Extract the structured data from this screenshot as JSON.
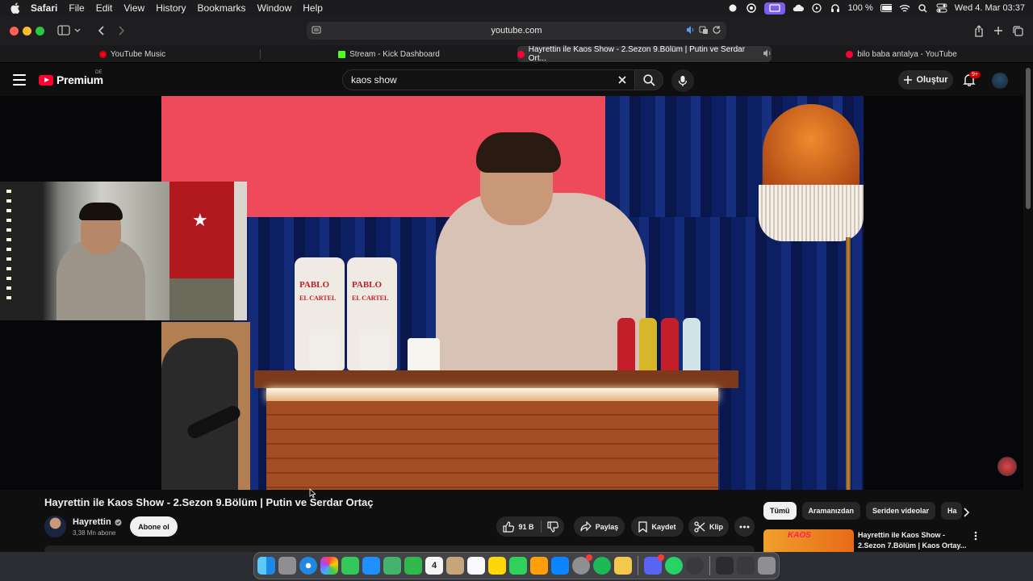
{
  "menubar": {
    "app": "Safari",
    "items": [
      "File",
      "Edit",
      "View",
      "History",
      "Bookmarks",
      "Window",
      "Help"
    ],
    "battery": "100 %",
    "datetime": "Wed 4. Mar  03:37"
  },
  "browser": {
    "url": "youtube.com",
    "tabs": [
      {
        "title": "YouTube Music",
        "icon": "youtube-music-icon"
      },
      {
        "title": "Stream - Kick Dashboard",
        "icon": "kick-icon"
      },
      {
        "title": "Hayrettin ile Kaos Show - 2.Sezon 9.Bölüm | Putin ve Serdar Ort...",
        "icon": "youtube-icon",
        "active": true
      },
      {
        "title": "bilo baba antalya - YouTube",
        "icon": "youtube-icon"
      }
    ]
  },
  "youtube": {
    "logo_text": "Premium",
    "country_code": "DE",
    "search_query": "kaos show",
    "create_label": "Oluştur",
    "notification_count": "9+"
  },
  "video": {
    "title": "Hayrettin ile Kaos Show - 2.Sezon 9.Bölüm | Putin ve Serdar Ortaç",
    "channel": "Hayrettin",
    "subscribers": "3,38 Mn abone",
    "subscribe_label": "Abone ol",
    "likes": "91 B",
    "share_label": "Paylaş",
    "save_label": "Kaydet",
    "clip_label": "Klip",
    "desk_bag_text": "PABLO",
    "desk_bag_sub": "EL CARTEL"
  },
  "sidebar": {
    "chips": [
      "Tümü",
      "Aramanızdan",
      "Seriden videolar",
      "Ha"
    ],
    "recommendation": {
      "title": "Hayrettin ile Kaos Show - 2.Sezon 7.Bölüm | Kaos Ortay...",
      "thumb_text": "KAOS"
    }
  },
  "colors": {
    "youtube_red": "#ff0033",
    "accent_purple": "#7b5cf0",
    "kick_green": "#53fc18"
  }
}
